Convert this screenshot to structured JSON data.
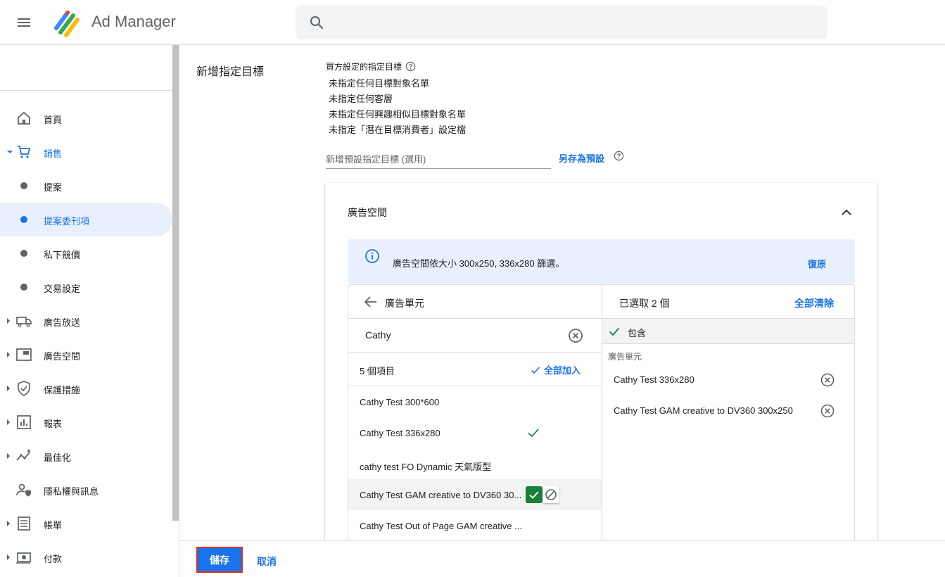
{
  "header": {
    "app_title": "Ad Manager",
    "menu_icon": "menu-icon",
    "search_icon": "search-icon"
  },
  "sidebar": {
    "items": [
      {
        "label": "首頁",
        "icon": "home-icon"
      },
      {
        "label": "銷售",
        "icon": "cart-icon"
      },
      {
        "label": "提案",
        "icon": "dot"
      },
      {
        "label": "提案委刊項",
        "icon": "dot"
      },
      {
        "label": "私下競價",
        "icon": "dot"
      },
      {
        "label": "交易設定",
        "icon": "dot"
      },
      {
        "label": "廣告放送",
        "icon": "truck-icon"
      },
      {
        "label": "廣告空間",
        "icon": "inventory-icon"
      },
      {
        "label": "保護措施",
        "icon": "shield-icon"
      },
      {
        "label": "報表",
        "icon": "report-icon"
      },
      {
        "label": "最佳化",
        "icon": "optimize-icon"
      },
      {
        "label": "隱私權與訊息",
        "icon": "privacy-icon"
      },
      {
        "label": "帳單",
        "icon": "billing-icon"
      },
      {
        "label": "付款",
        "icon": "payment-icon"
      }
    ]
  },
  "main": {
    "section_title": "新增指定目標",
    "buyer_targeting_title": "買方設定的指定目標",
    "buyer_lines": [
      "未指定任何目標對象名單",
      "未指定任何客層",
      "未指定任何興趣相似目標對象名單",
      "未指定「潛在目標消費者」設定檔"
    ],
    "preset_placeholder": "新增預設指定目標 (選用)",
    "save_as_preset": "另存為預設",
    "card": {
      "title": "廣告空間",
      "info_text": "廣告空間依大小 300x250, 336x280 篩選。",
      "restore": "復原",
      "left": {
        "header": "廣告單元",
        "search_value": "Cathy",
        "count": "5 個項目",
        "add_all": "全部加入",
        "items": [
          "Cathy Test 300*600",
          "Cathy Test 336x280",
          "cathy test FO Dynamic 天氣版型",
          "Cathy Test GAM creative to DV360 30...",
          "Cathy Test Out of Page GAM creative ..."
        ]
      },
      "right": {
        "selected_count": "已選取 2 個",
        "clear_all": "全部清除",
        "include_label": "包含",
        "group_label": "廣告單元",
        "items": [
          "Cathy Test 336x280",
          "Cathy Test GAM creative to DV360 300x250"
        ]
      }
    }
  },
  "footer": {
    "save": "儲存",
    "cancel": "取消"
  },
  "colors": {
    "accent": "#1a73e8",
    "include_green": "#188038",
    "active_nav_bg": "#e8f0fe",
    "save_outline": "#d93025"
  }
}
